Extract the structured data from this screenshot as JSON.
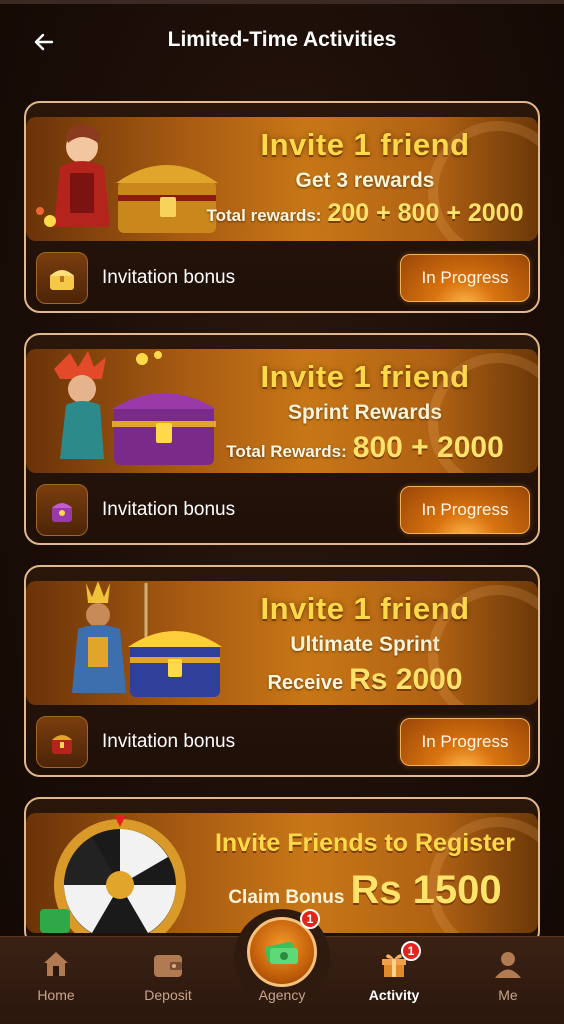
{
  "header": {
    "title": "Limited-Time Activities",
    "back_icon": "arrow-left-icon"
  },
  "cards": [
    {
      "title": "Invite 1 friend",
      "subtitle": "Get 3 rewards",
      "total_label": "Total rewards:",
      "total_value": "200 + 800 + 2000",
      "bonus_label": "Invitation bonus",
      "button": "In Progress"
    },
    {
      "title": "Invite 1 friend",
      "subtitle": "Sprint Rewards",
      "total_label": "Total Rewards:",
      "total_value": "800 + 2000",
      "bonus_label": "Invitation bonus",
      "button": "In Progress"
    },
    {
      "title": "Invite 1 friend",
      "subtitle": "Ultimate Sprint",
      "total_label": "Receive",
      "total_value": "Rs 2000",
      "bonus_label": "Invitation bonus",
      "button": "In Progress"
    }
  ],
  "card4": {
    "title": "Invite Friends to Register",
    "claim_label": "Claim Bonus",
    "claim_value": "Rs 1500"
  },
  "tabs": {
    "home": "Home",
    "deposit": "Deposit",
    "agency": "Agency",
    "agency_badge": "1",
    "activity": "Activity",
    "activity_badge": "1",
    "me": "Me"
  },
  "colors": {
    "accent": "#d9740f",
    "gold": "#ffd94a",
    "badge": "#e2241c"
  }
}
